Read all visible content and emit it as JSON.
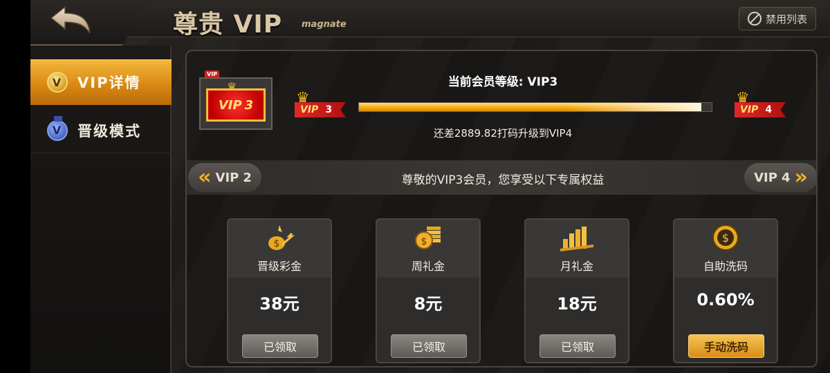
{
  "header": {
    "title": "尊贵 VIP",
    "subtitle": "magnate",
    "ban_list_label": "禁用列表"
  },
  "sidebar": {
    "items": [
      {
        "label": "VIP详情",
        "icon": "v-coin-icon",
        "active": true
      },
      {
        "label": "晋级模式",
        "icon": "medal-icon",
        "active": false
      }
    ]
  },
  "status": {
    "badge_corner": "VIP",
    "badge_text": "VIP",
    "badge_level": "3",
    "current_level_text": "当前会员等级: VIP3",
    "progress_fraction": 0.97,
    "from_tag": "VIP",
    "from_num": "3",
    "to_tag": "VIP",
    "to_num": "4",
    "remaining_text": "还差2889.82打码升级到VIP4"
  },
  "level_nav": {
    "prev_label": "VIP",
    "prev_num": "2",
    "next_label": "VIP",
    "next_num": "4",
    "description": "尊敬的VIP3会员，您享受以下专属权益"
  },
  "benefits": [
    {
      "name": "promotion-bonus",
      "label": "晋级彩金",
      "value": "38元",
      "button": "已领取",
      "icon": "money-bag-icon"
    },
    {
      "name": "weekly-bonus",
      "label": "周礼金",
      "value": "8元",
      "button": "已领取",
      "icon": "coin-stack-icon"
    },
    {
      "name": "monthly-bonus",
      "label": "月礼金",
      "value": "18元",
      "button": "已领取",
      "icon": "bar-chart-icon"
    },
    {
      "name": "self-rebate",
      "label": "自助洗码",
      "value": "0.60%",
      "button": "手动洗码",
      "icon": "dollar-coin-icon"
    }
  ],
  "colors": {
    "accent_gold": "#f5a410",
    "tag_red": "#d62020",
    "panel_bg": "#1a1816"
  }
}
